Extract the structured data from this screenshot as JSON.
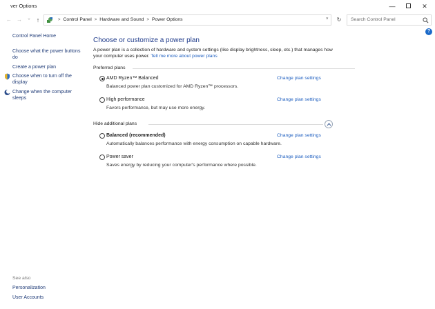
{
  "window": {
    "title": "ver Options",
    "minimize": "—",
    "close": "✕"
  },
  "address": {
    "back": "←",
    "forward": "→",
    "recent": "˅",
    "up": "↑",
    "crumbs": [
      "Control Panel",
      "Hardware and Sound",
      "Power Options"
    ],
    "separator": ">",
    "dropdown": "˅",
    "refresh": "↻"
  },
  "search": {
    "placeholder": "Search Control Panel"
  },
  "help": {
    "label": "?"
  },
  "sidebar": {
    "home": "Control Panel Home",
    "links": [
      "Choose what the power buttons do",
      "Create a power plan",
      "Choose when to turn off the display",
      "Change when the computer sleeps"
    ],
    "see_also": "See also",
    "see_also_links": [
      "Personalization",
      "User Accounts"
    ]
  },
  "main": {
    "heading": "Choose or customize a power plan",
    "intro": "A power plan is a collection of hardware and system settings (like display brightness, sleep, etc.) that manages how your computer uses power.",
    "intro_link": "Tell me more about power plans",
    "preferred_label": "Preferred plans",
    "additional_label": "Hide additional plans",
    "change_link": "Change plan settings",
    "plans": [
      {
        "name": "AMD Ryzen™ Balanced",
        "desc": "Balanced power plan customized for AMD Ryzen™ processors.",
        "selected": true,
        "bold": false
      },
      {
        "name": "High performance",
        "desc": "Favors performance, but may use more energy.",
        "selected": false,
        "bold": false
      },
      {
        "name": "Balanced (recommended)",
        "desc": "Automatically balances performance with energy consumption on capable hardware.",
        "selected": false,
        "bold": true
      },
      {
        "name": "Power saver",
        "desc": "Saves energy by reducing your computer's performance where possible.",
        "selected": false,
        "bold": false
      }
    ]
  },
  "colors": {
    "heading": "#1e3a8a",
    "link": "#1c5dbf",
    "sidebar_link": "#1f3b77",
    "help": "#1b6ac9"
  }
}
